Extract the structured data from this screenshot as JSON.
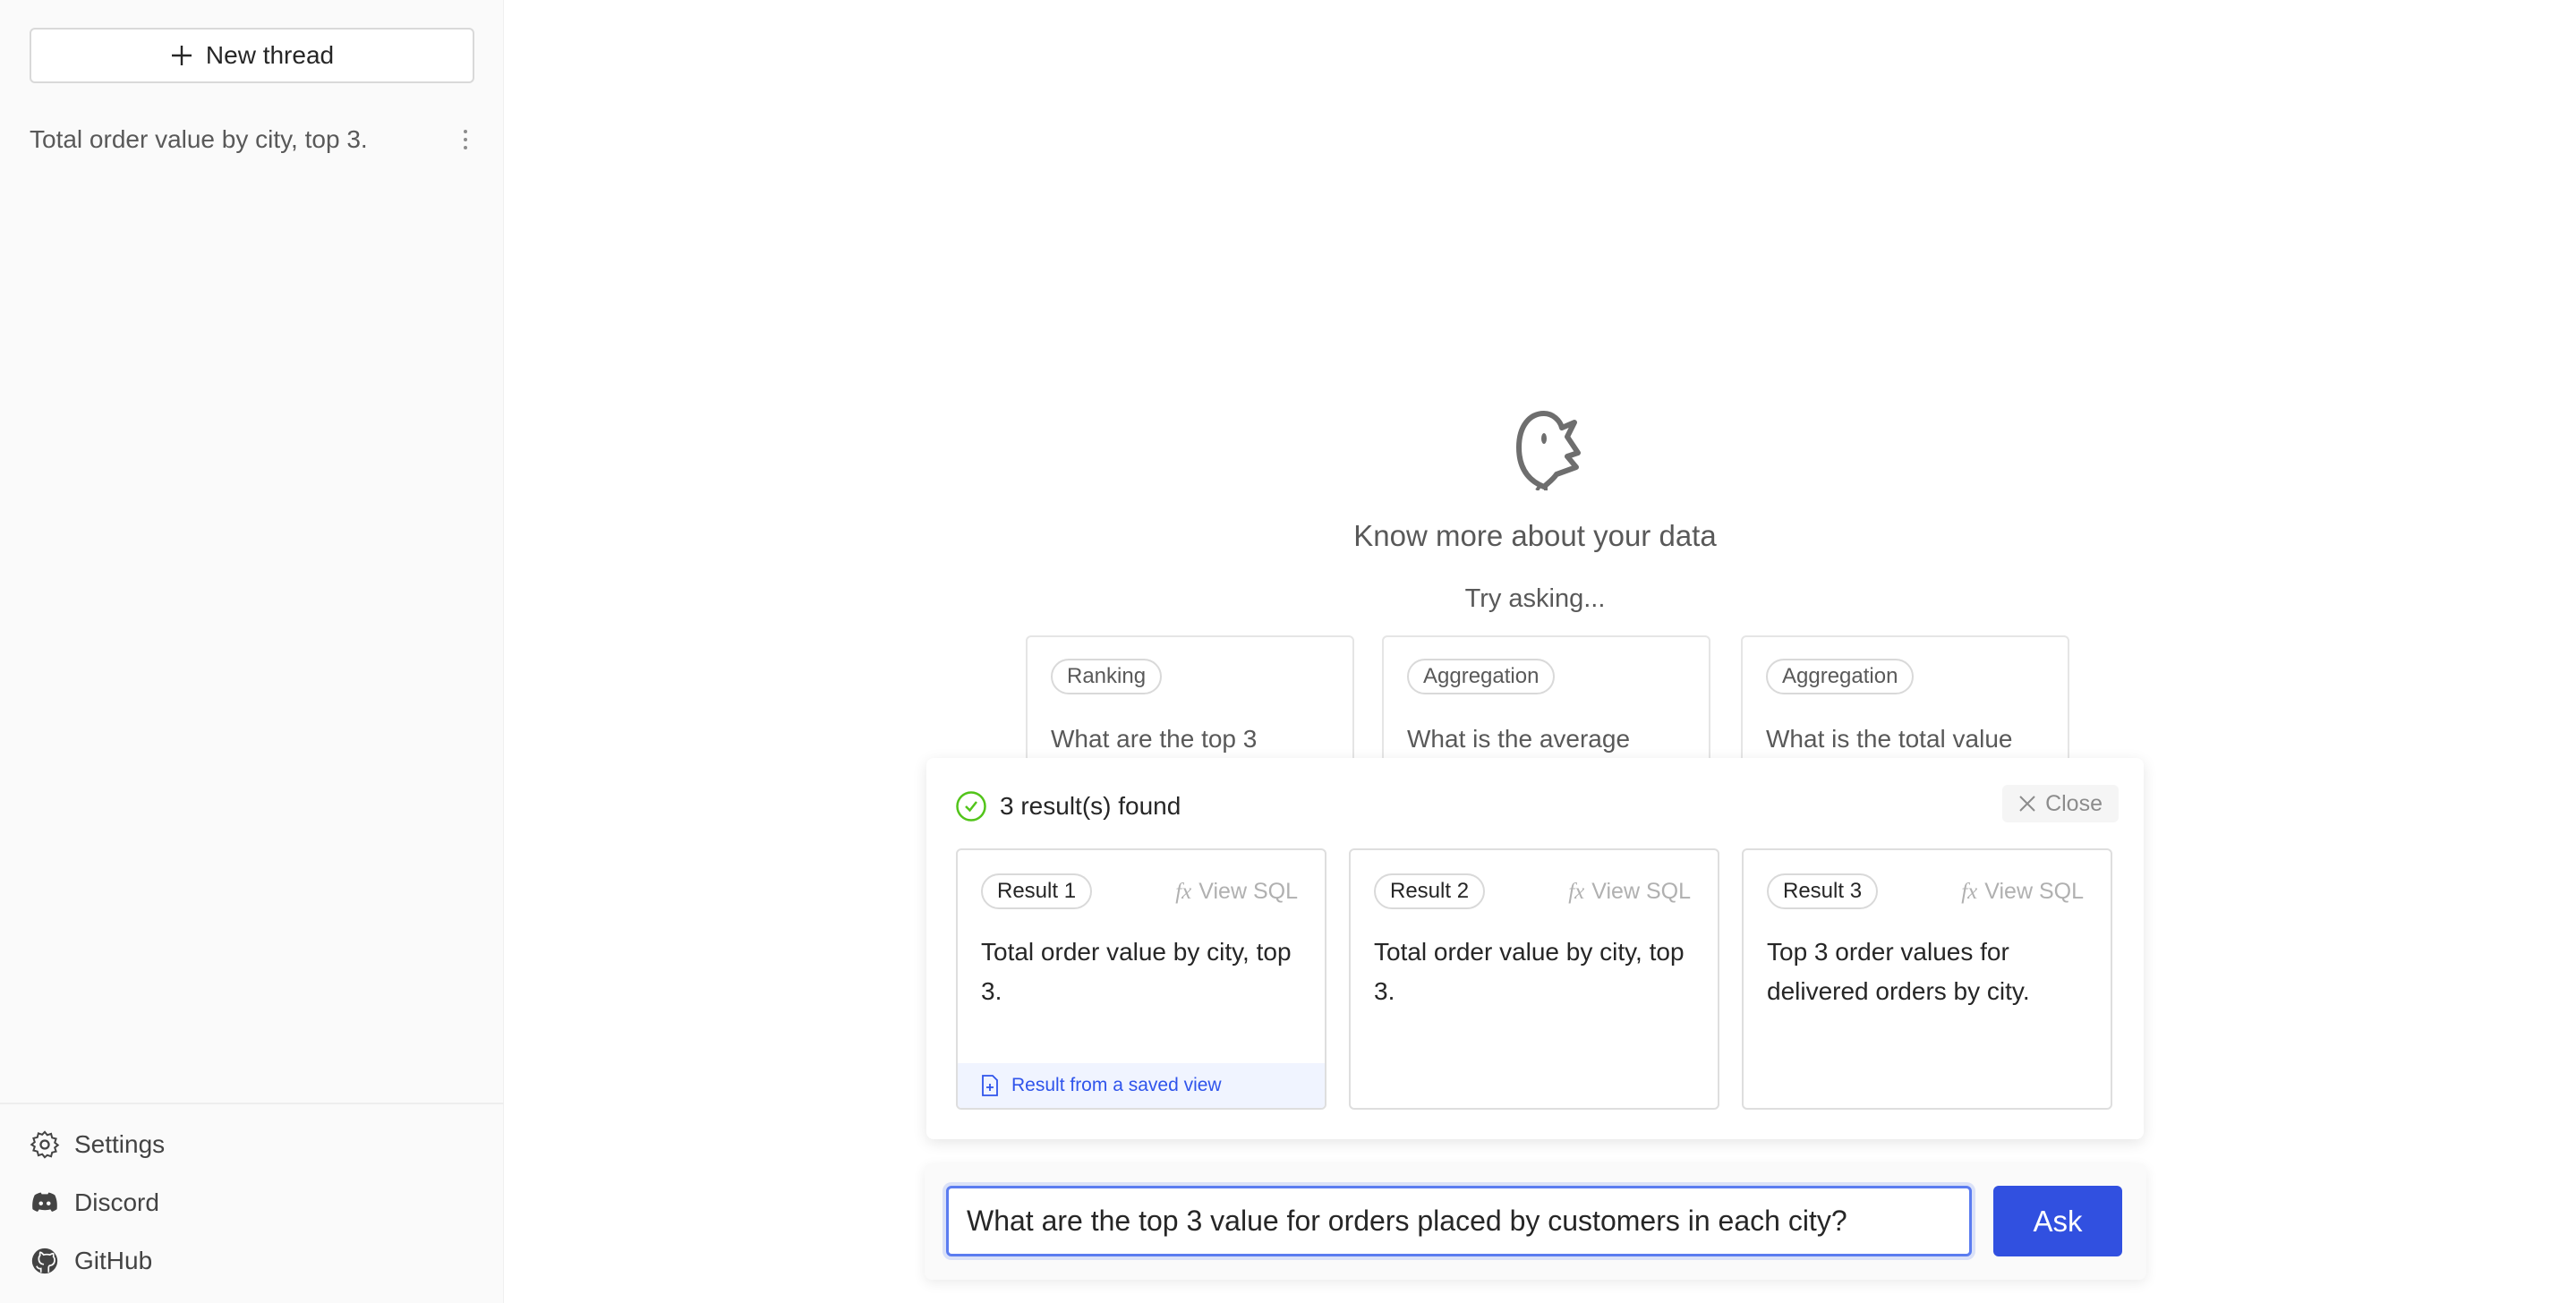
{
  "sidebar": {
    "new_thread": "New thread",
    "threads": [
      {
        "title": "Total order value by city, top 3."
      }
    ],
    "footer": [
      {
        "label": "Settings",
        "icon": "gear-icon"
      },
      {
        "label": "Discord",
        "icon": "discord-icon"
      },
      {
        "label": "GitHub",
        "icon": "github-icon"
      }
    ]
  },
  "main": {
    "title": "Know more about your data",
    "try_asking": "Try asking...",
    "suggestions": [
      {
        "tag": "Ranking",
        "text": "What are the top 3"
      },
      {
        "tag": "Aggregation",
        "text": "What is the average"
      },
      {
        "tag": "Aggregation",
        "text": "What is the total value"
      }
    ]
  },
  "results": {
    "status": "3 result(s) found",
    "close": "Close",
    "view_sql": "View SQL",
    "fx": "fx",
    "items": [
      {
        "label": "Result 1",
        "text": "Total order value by city, top 3.",
        "note": "Result from a saved view"
      },
      {
        "label": "Result 2",
        "text": "Total order value by city, top 3."
      },
      {
        "label": "Result 3",
        "text": "Top 3 order values for delivered orders by city."
      }
    ]
  },
  "prompt": {
    "value": "What are the top 3 value for orders placed by customers in each city?",
    "ask": "Ask"
  },
  "colors": {
    "accent": "#3150e0",
    "success": "#52c41a",
    "saved_view_bg": "#f0f4ff"
  }
}
